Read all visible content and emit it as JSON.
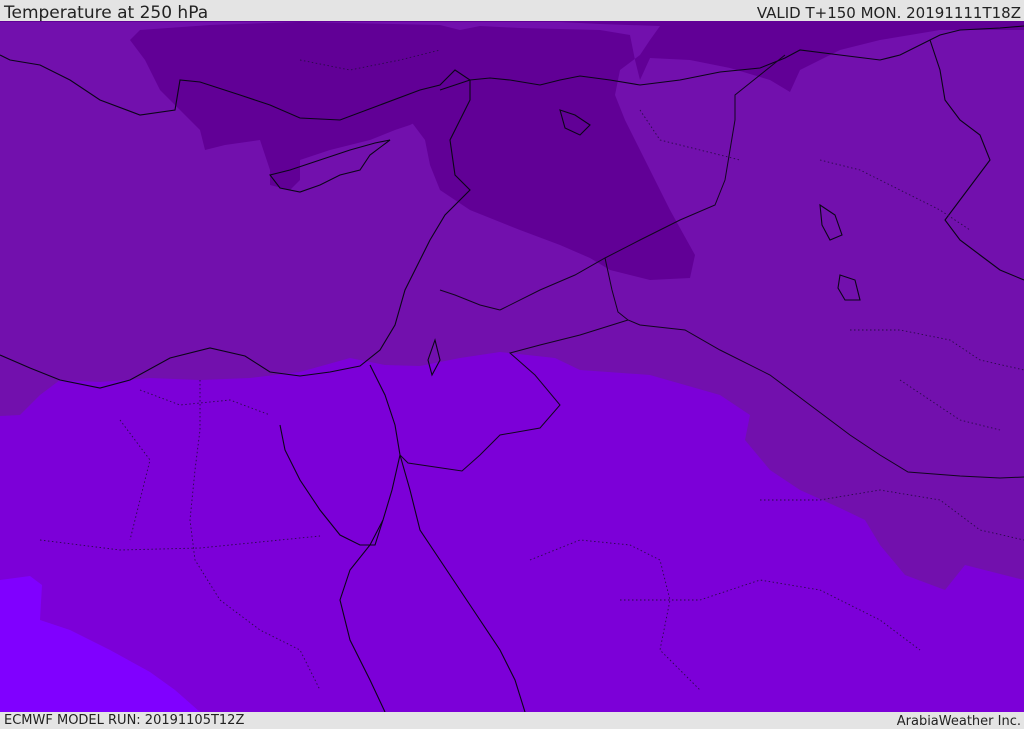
{
  "header": {
    "title": "Temperature at 250 hPa",
    "valid_time": "VALID T+150 MON. 20191111T18Z"
  },
  "footer": {
    "model_run": "ECMWF MODEL RUN: 20191105T12Z",
    "credit": "ArabiaWeather Inc."
  },
  "map": {
    "colors": {
      "coldest": "#610096",
      "cold": "#7210ad",
      "mild": "#7c00d8",
      "warm": "#8000ff",
      "coastline": "#0b0518",
      "border": "#12051f"
    }
  }
}
